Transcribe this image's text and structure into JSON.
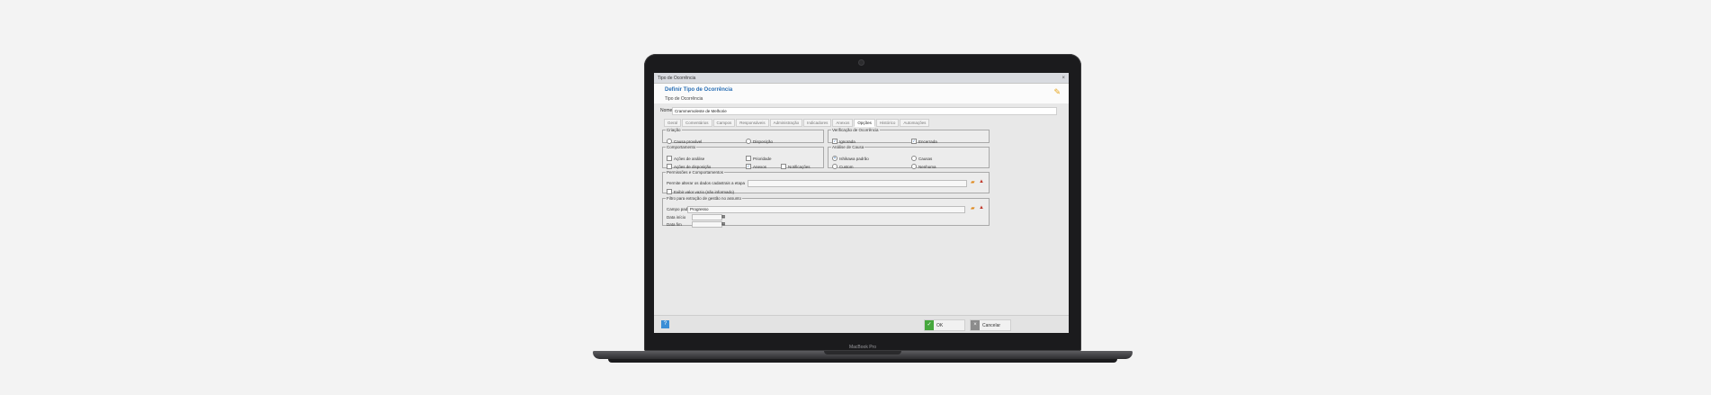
{
  "window": {
    "title": "Tipo de Ocorrência",
    "close": "×"
  },
  "header": {
    "title": "Definir Tipo de Ocorrência",
    "subtitle": "Tipo de Ocorrência"
  },
  "name_row": {
    "label": "Nome",
    "value": "Crammemoleste de Melhorie"
  },
  "tabs": [
    "Geral",
    "Comentários",
    "Campos",
    "Responsáveis",
    "Administração",
    "Indicadores",
    "Anexos",
    "Opções",
    "Histórico",
    "Automações"
  ],
  "active_tab": "Opções",
  "sections": {
    "criacao": {
      "legend": "Criação",
      "options": [
        "Causa provável",
        "Disposição"
      ]
    },
    "verificacao": {
      "legend": "Verificação de Ocorrência",
      "options": [
        "Ignorada",
        "Encerrada"
      ]
    },
    "comportamento": {
      "legend": "Comportamento",
      "options": [
        "Ações de análise",
        "Prioridade",
        "Ações de disposição",
        "Anexos",
        "Notificações"
      ]
    },
    "analise": {
      "legend": "Análise de Causa",
      "options": [
        "Ishikawa padrão",
        "Causas",
        "Custom",
        "Nenhuma"
      ]
    },
    "permissoes": {
      "legend": "Permissões e Comportamentos",
      "field_label": "Permite alterar os dados cadastrais a etapa",
      "field_value": "",
      "checkbox_label": "Exibir valor vazio (não informado)"
    },
    "filtro": {
      "legend": "Filtro para extração de gestão no assunto",
      "campo_label": "Campo padrão",
      "campo_value": "Progresso",
      "data_inicio_label": "Data início",
      "data_inicio_value": "",
      "data_fim_label": "Data fim",
      "data_fim_value": ""
    }
  },
  "footer": {
    "ok_label": "OK",
    "cancel_label": "Cancelar"
  },
  "laptop_brand": "MacBook Pro",
  "icons": {
    "header_icon": "tag-icon",
    "folder": "folder-icon",
    "clear": "clear-icon",
    "help": "help-icon",
    "calendar": "calendar-icon"
  },
  "colors": {
    "title_blue": "#2a6fb5",
    "ok_green": "#46a73d",
    "help_blue": "#3b8ed6",
    "accent_orange": "#e08a1e"
  }
}
